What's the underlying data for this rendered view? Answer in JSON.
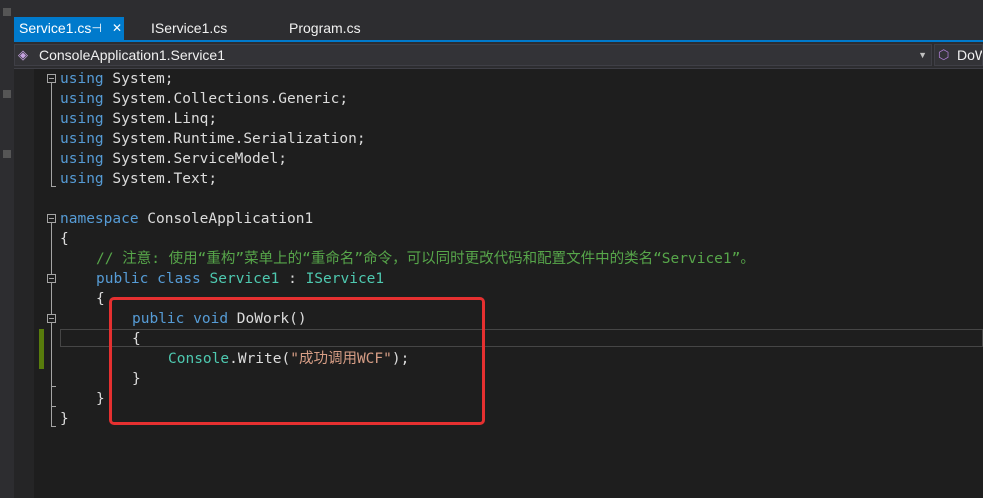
{
  "tabs": [
    {
      "label": "Service1.cs",
      "active": true,
      "pin_icon": "pin-icon"
    },
    {
      "label": "IService1.cs",
      "active": false
    },
    {
      "label": "Program.cs",
      "active": false
    }
  ],
  "navigation": {
    "type_selector": "ConsoleApplication1.Service1",
    "member_selector": "DoWork()"
  },
  "code_lines": [
    {
      "kw": "using",
      "rest": " System;"
    },
    {
      "kw": "using",
      "rest": " System.Collections.Generic;"
    },
    {
      "kw": "using",
      "rest": " System.Linq;"
    },
    {
      "kw": "using",
      "rest": " System.Runtime.Serialization;"
    },
    {
      "kw": "using",
      "rest": " System.ServiceModel;"
    },
    {
      "kw": "using",
      "rest": " System.Text;"
    },
    {
      "kw": "namespace",
      "rest": " ConsoleApplication1"
    },
    {
      "text": "{"
    },
    {
      "comment": "// 注意: 使用“重构”菜单上的“重命名”命令，可以同时更改代码和配置文件中的类名“Service1”。"
    },
    {
      "kw1": "public",
      "kw2": "class",
      "type": "Service1",
      "sep": " : ",
      "type2": "IService1"
    },
    {
      "text": "{"
    },
    {
      "kw1": "public",
      "kw2": "void",
      "rest": " DoWork()"
    },
    {
      "text": "{"
    },
    {
      "type": "Console",
      "rest": ".Write(",
      "str": "\"成功调用WCF\"",
      "end": ");"
    },
    {
      "text": "}"
    },
    {
      "text": "}"
    },
    {
      "text": "}"
    }
  ],
  "colors": {
    "keyword": "#569cd6",
    "type": "#4ec9b0",
    "comment": "#57a64a",
    "string": "#d69d85",
    "highlight_border": "#e53030",
    "active_tab": "#007acc"
  }
}
